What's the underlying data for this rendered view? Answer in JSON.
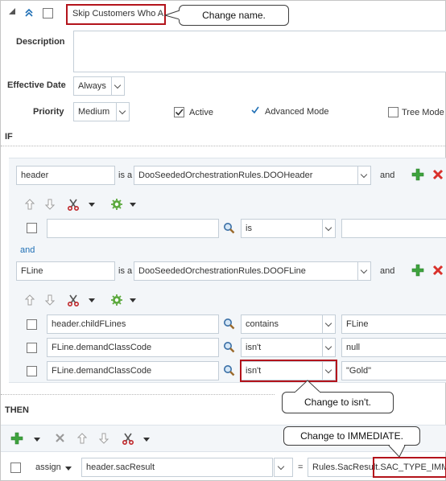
{
  "rule": {
    "name_value": "Skip Customers Who Ar",
    "description_label": "Description",
    "effective_date_label": "Effective Date",
    "effective_date_value": "Always",
    "priority_label": "Priority",
    "priority_value": "Medium",
    "active_label": "Active",
    "advanced_mode_label": "Advanced Mode",
    "tree_mode_label": "Tree Mode"
  },
  "if_section": {
    "label": "IF",
    "header_var": "header",
    "is_a": "is a",
    "header_type": "DooSeededOrchestrationRules.DOOHeader",
    "and": "and",
    "condition_operator": "is",
    "and_connector": "and",
    "fline_var": "FLine",
    "fline_type": "DooSeededOrchestrationRules.DOOFLine",
    "conditions": [
      {
        "left": "header.childFLines",
        "operator": "contains",
        "right": "FLine"
      },
      {
        "left": "FLine.demandClassCode",
        "operator": "isn't",
        "right": "null"
      },
      {
        "left": "FLine.demandClassCode",
        "operator": "isn't",
        "right": "\"Gold\""
      }
    ]
  },
  "then_section": {
    "label": "THEN",
    "action": "assign",
    "target": "header.sacResult",
    "equals": "=",
    "value_prefix": "Rules.SacResult.",
    "value_suffix": "SAC_TYPE_IMM"
  },
  "callouts": {
    "change_name": "Change name.",
    "change_to_isnt": "Change to isn't.",
    "change_to_immediate": "Change to IMMEDIATE."
  },
  "colors": {
    "highlight_red": "#b3131b",
    "add_green": "#3ea33e",
    "delete_red": "#d9312b",
    "link_blue": "#1f6fb5"
  }
}
